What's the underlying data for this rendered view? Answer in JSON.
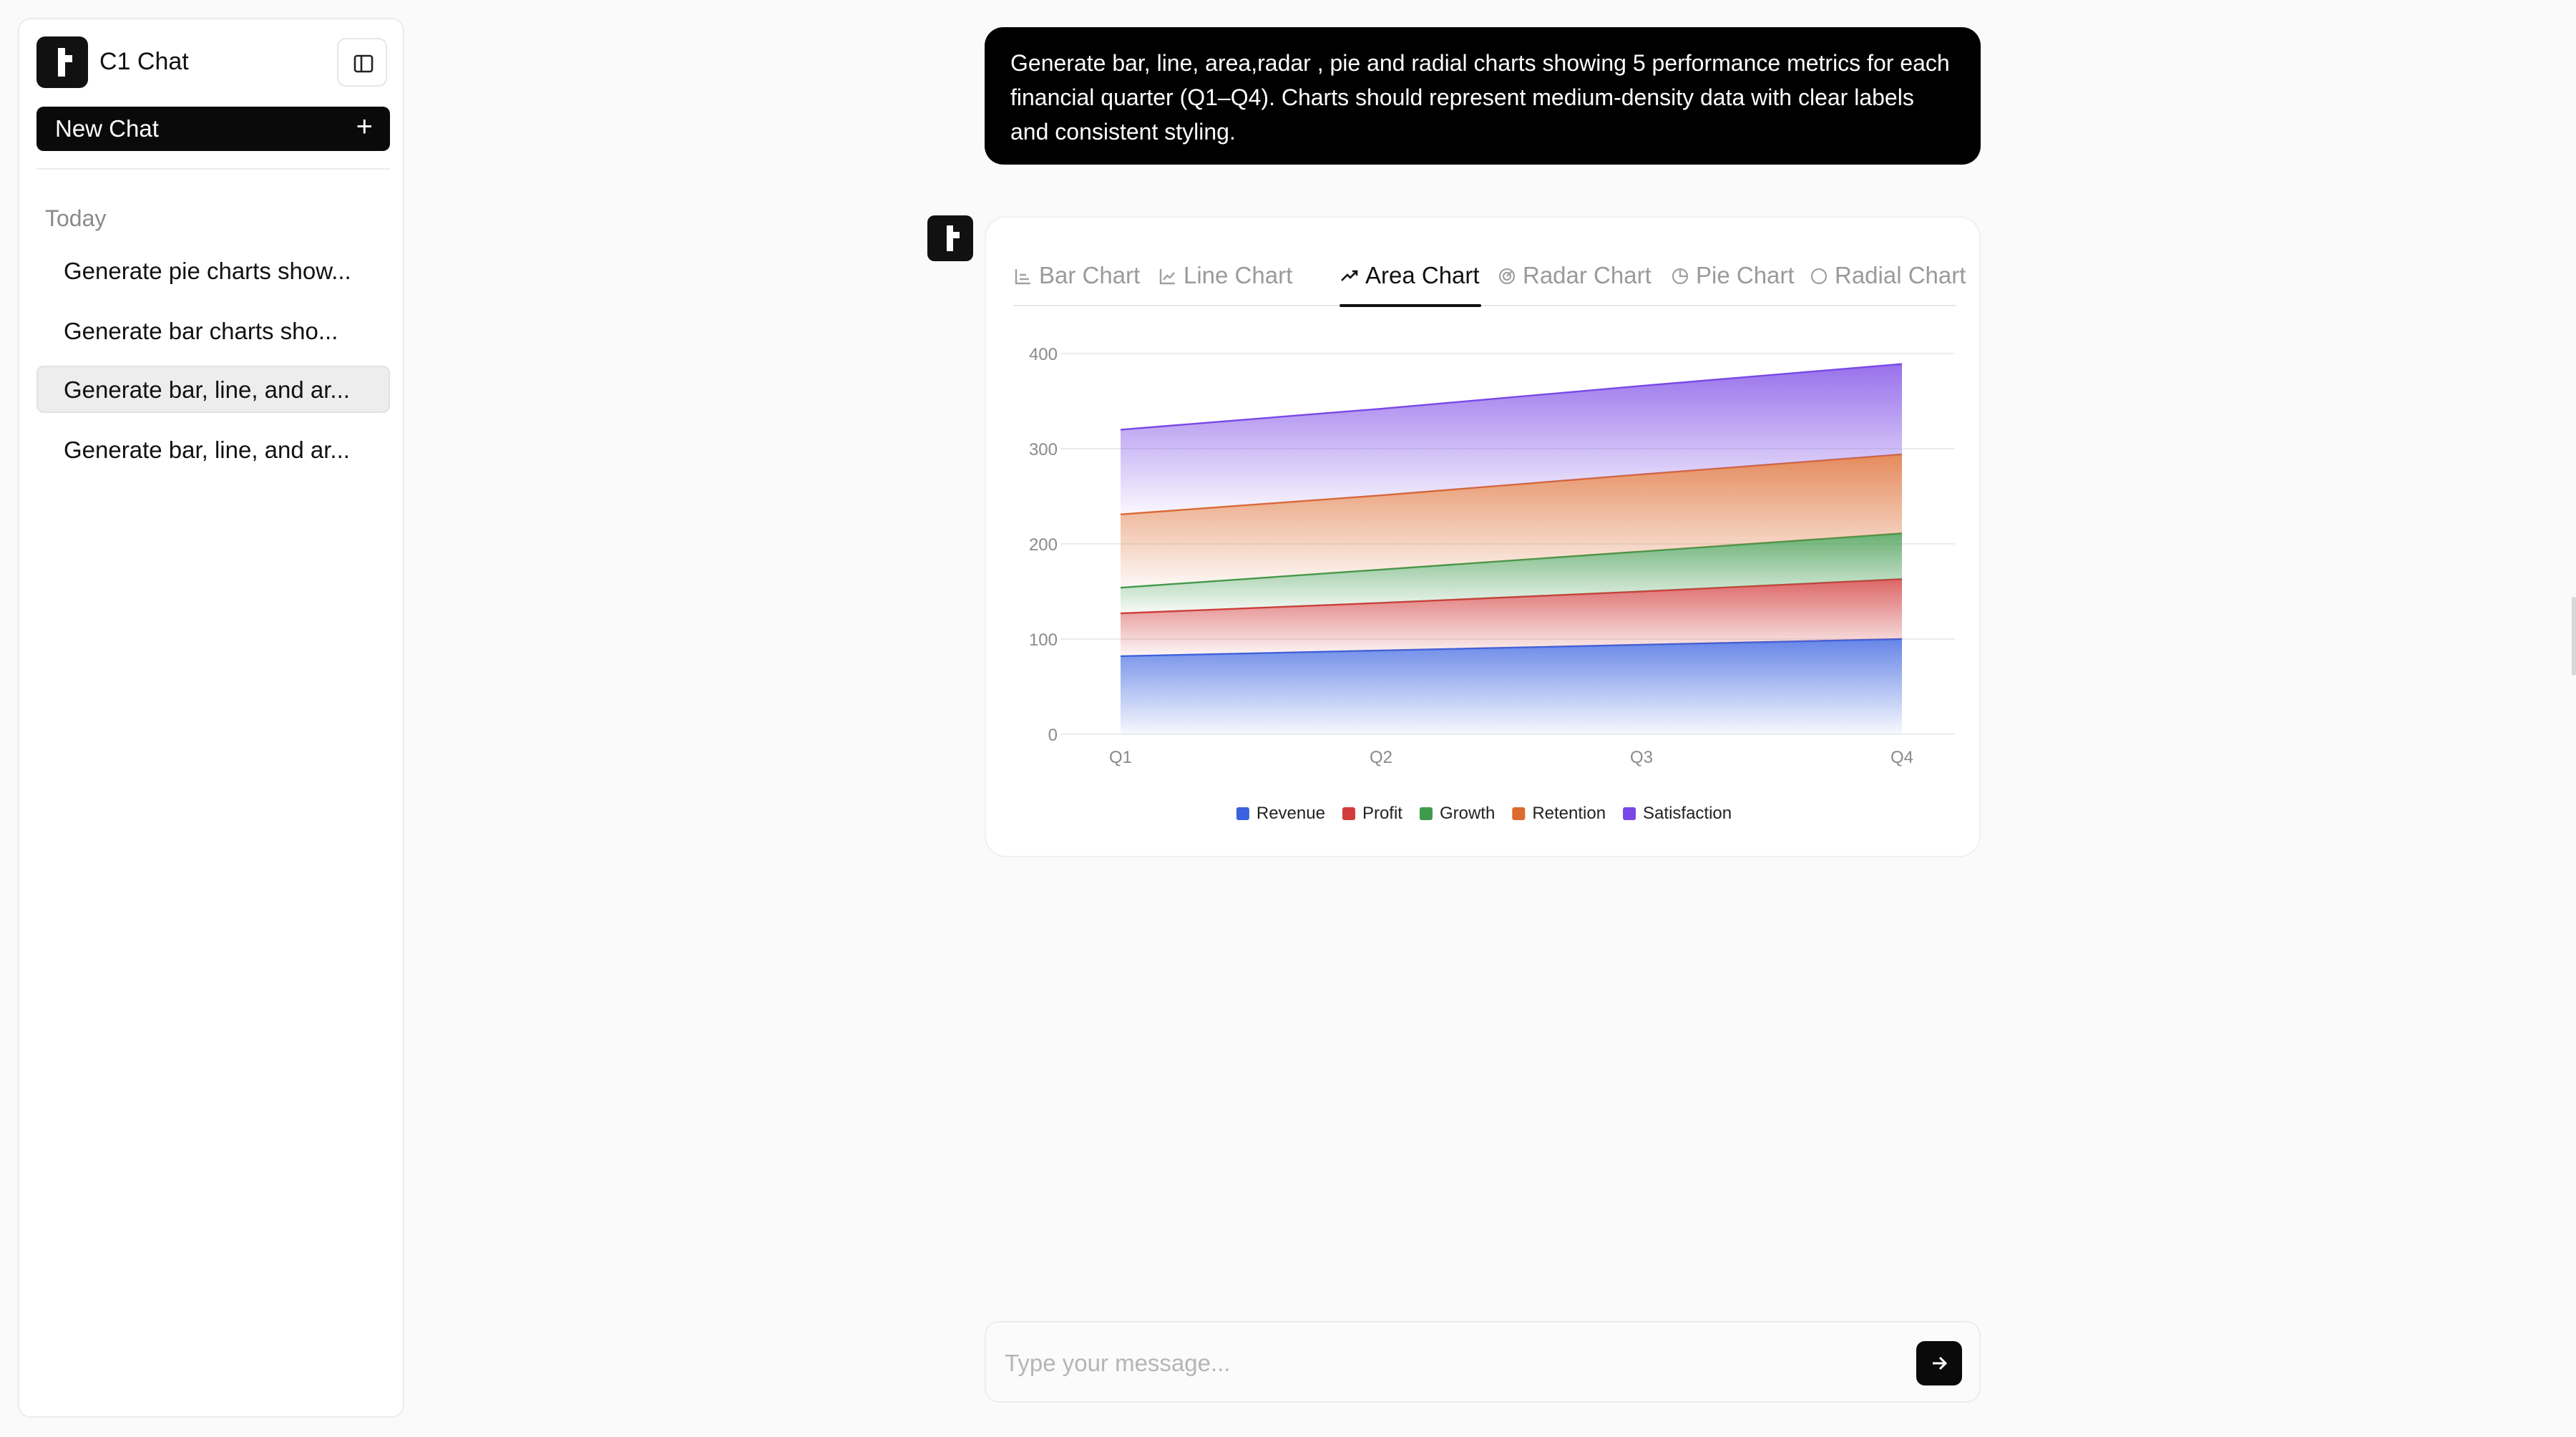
{
  "sidebar": {
    "app_title": "C1 Chat",
    "new_chat_label": "New Chat",
    "new_chat_icon": "plus-icon",
    "section_label": "Today",
    "history": [
      {
        "label": "Generate pie charts show...",
        "active": false
      },
      {
        "label": "Generate bar charts sho...",
        "active": false
      },
      {
        "label": "Generate bar, line, and ar...",
        "active": true
      },
      {
        "label": "Generate bar, line, and ar...",
        "active": false
      }
    ]
  },
  "prompt": {
    "text": "Generate bar, line, area,radar , pie and radial charts showing 5 performance metrics for each financial quarter (Q1–Q4). Charts should represent medium-density data with clear labels and consistent styling."
  },
  "response": {
    "tabs": [
      {
        "label": "Bar Chart",
        "icon": "bar-chart-icon",
        "active": false
      },
      {
        "label": "Line Chart",
        "icon": "line-chart-icon",
        "active": false
      },
      {
        "label": "Area Chart",
        "icon": "trend-icon",
        "active": true
      },
      {
        "label": "Radar Chart",
        "icon": "radar-chart-icon",
        "active": false
      },
      {
        "label": "Pie Chart",
        "icon": "pie-chart-icon",
        "active": false
      },
      {
        "label": "Radial Chart",
        "icon": "radial-chart-icon",
        "active": false
      }
    ]
  },
  "chart_data": {
    "type": "area",
    "stacked": true,
    "categories": [
      "Q1",
      "Q2",
      "Q3",
      "Q4"
    ],
    "ylim": [
      0,
      400
    ],
    "yticks": [
      0,
      100,
      200,
      300,
      400
    ],
    "grid": true,
    "legend_position": "bottom",
    "series": [
      {
        "name": "Revenue",
        "color": "#3b63e0",
        "values": [
          82,
          88,
          94,
          100
        ]
      },
      {
        "name": "Profit",
        "color": "#d23b3b",
        "values": [
          45,
          50,
          56,
          63
        ]
      },
      {
        "name": "Growth",
        "color": "#3f9a4b",
        "values": [
          27,
          35,
          42,
          48
        ]
      },
      {
        "name": "Retention",
        "color": "#dd6a2e",
        "values": [
          77,
          78,
          81,
          83
        ]
      },
      {
        "name": "Satisfaction",
        "color": "#7a48e6",
        "values": [
          89,
          91,
          93,
          95
        ]
      }
    ]
  },
  "input": {
    "placeholder": "Type your message...",
    "send_icon": "arrow-right-icon"
  }
}
